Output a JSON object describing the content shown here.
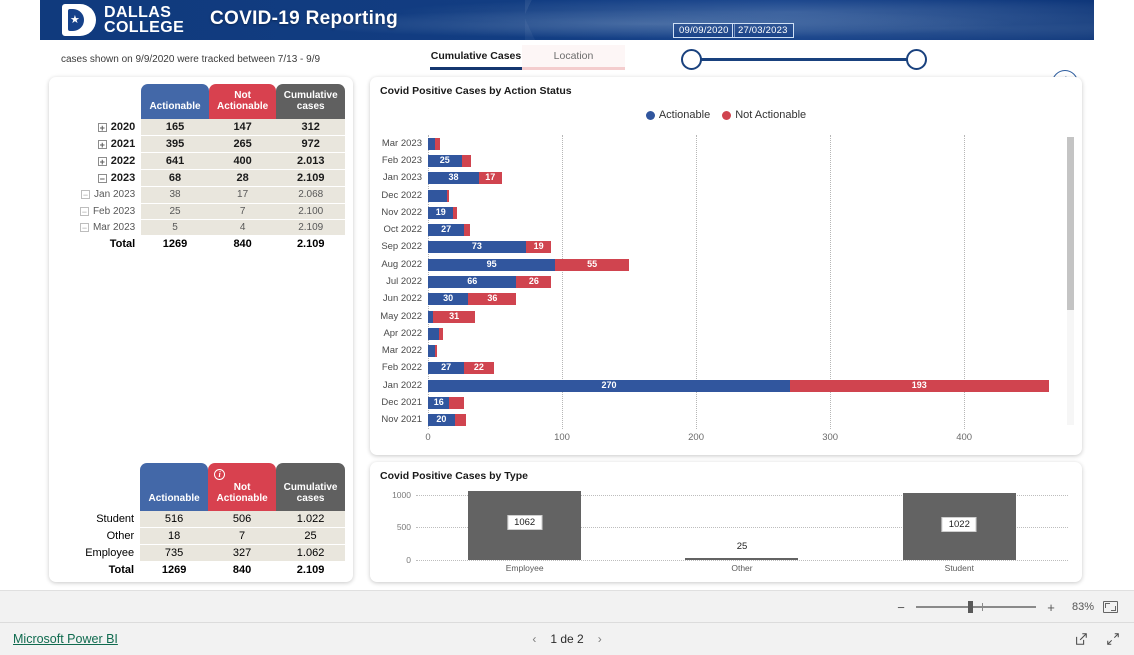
{
  "header": {
    "logo_line1": "DALLAS",
    "logo_line2": "COLLEGE",
    "logo_icon": "dallas-college-d-star-logo",
    "title": "COVID-19  Reporting",
    "date_start": "09/09/2020",
    "date_end": "27/03/2023"
  },
  "note": "cases shown on 9/9/2020 were tracked between 7/13 - 9/9",
  "tabs": [
    {
      "label": "Cumulative Cases",
      "active": true
    },
    {
      "label": "Location",
      "active": false
    }
  ],
  "info_icon": "info-icon",
  "matrix_year": {
    "columns": [
      "Actionable",
      "Not Actionable",
      "Cumulative cases"
    ],
    "rows": [
      {
        "label": "2020",
        "level": 0,
        "toggle": "+",
        "actionable": "165",
        "not_actionable": "147",
        "cumulative": "312"
      },
      {
        "label": "2021",
        "level": 0,
        "toggle": "+",
        "actionable": "395",
        "not_actionable": "265",
        "cumulative": "972"
      },
      {
        "label": "2022",
        "level": 0,
        "toggle": "+",
        "actionable": "641",
        "not_actionable": "400",
        "cumulative": "2.013"
      },
      {
        "label": "2023",
        "level": 0,
        "toggle": "−",
        "actionable": "68",
        "not_actionable": "28",
        "cumulative": "2.109"
      },
      {
        "label": "Jan 2023",
        "level": 1,
        "toggle": "−",
        "actionable": "38",
        "not_actionable": "17",
        "cumulative": "2.068"
      },
      {
        "label": "Feb 2023",
        "level": 1,
        "toggle": "−",
        "actionable": "25",
        "not_actionable": "7",
        "cumulative": "2.100"
      },
      {
        "label": "Mar 2023",
        "level": 1,
        "toggle": "−",
        "actionable": "5",
        "not_actionable": "4",
        "cumulative": "2.109"
      }
    ],
    "total": {
      "label": "Total",
      "actionable": "1269",
      "not_actionable": "840",
      "cumulative": "2.109"
    }
  },
  "matrix_type": {
    "columns": [
      "Actionable",
      "Not Actionable",
      "Cumulative cases"
    ],
    "header_info_icon": "info-icon",
    "rows": [
      {
        "label": "Student",
        "actionable": "516",
        "not_actionable": "506",
        "cumulative": "1.022"
      },
      {
        "label": "Other",
        "actionable": "18",
        "not_actionable": "7",
        "cumulative": "25"
      },
      {
        "label": "Employee",
        "actionable": "735",
        "not_actionable": "327",
        "cumulative": "1.062"
      }
    ],
    "total": {
      "label": "Total",
      "actionable": "1269",
      "not_actionable": "840",
      "cumulative": "2.109"
    }
  },
  "chart_data": [
    {
      "type": "bar",
      "title": "Covid Positive Cases by Action Status",
      "orientation": "horizontal",
      "stacked": true,
      "xlabel": "",
      "ylabel": "",
      "xlim": [
        0,
        470
      ],
      "xticks": [
        0,
        100,
        200,
        300,
        400
      ],
      "grid": true,
      "legend": [
        "Actionable",
        "Not Actionable"
      ],
      "legend_position": "top-center",
      "colors": {
        "Actionable": "#31569e",
        "Not Actionable": "#d0444f"
      },
      "categories": [
        "Mar 2023",
        "Feb 2023",
        "Jan 2023",
        "Dec 2022",
        "Nov 2022",
        "Oct 2022",
        "Sep 2022",
        "Aug 2022",
        "Jul 2022",
        "Jun 2022",
        "May 2022",
        "Apr 2022",
        "Mar 2022",
        "Feb 2022",
        "Jan 2022",
        "Dec 2021",
        "Nov 2021"
      ],
      "series": [
        {
          "name": "Actionable",
          "values": [
            5,
            25,
            38,
            14,
            19,
            27,
            73,
            95,
            66,
            30,
            4,
            8,
            5,
            27,
            270,
            16,
            20
          ]
        },
        {
          "name": "Not Actionable",
          "values": [
            4,
            7,
            17,
            2,
            3,
            4,
            19,
            55,
            26,
            36,
            31,
            3,
            2,
            22,
            193,
            11,
            8
          ]
        }
      ]
    },
    {
      "type": "bar",
      "title": "Covid Positive Cases by Type",
      "orientation": "vertical",
      "categories": [
        "Employee",
        "Other",
        "Student"
      ],
      "values": [
        1062,
        25,
        1022
      ],
      "ylim": [
        0,
        1100
      ],
      "yticks": [
        0,
        500,
        1000
      ],
      "grid": true,
      "color": "#636363",
      "xlabel": "",
      "ylabel": ""
    }
  ],
  "zoombar": {
    "minus": "−",
    "plus": "+",
    "percent": "83%",
    "fit_icon": "fit-to-page-icon"
  },
  "statusbar": {
    "brand_link": "Microsoft Power BI",
    "prev_icon": "chevron-left-icon",
    "next_icon": "chevron-right-icon",
    "page_label": "1 de 2",
    "share_icon": "share-icon",
    "fullscreen_icon": "fullscreen-icon"
  }
}
